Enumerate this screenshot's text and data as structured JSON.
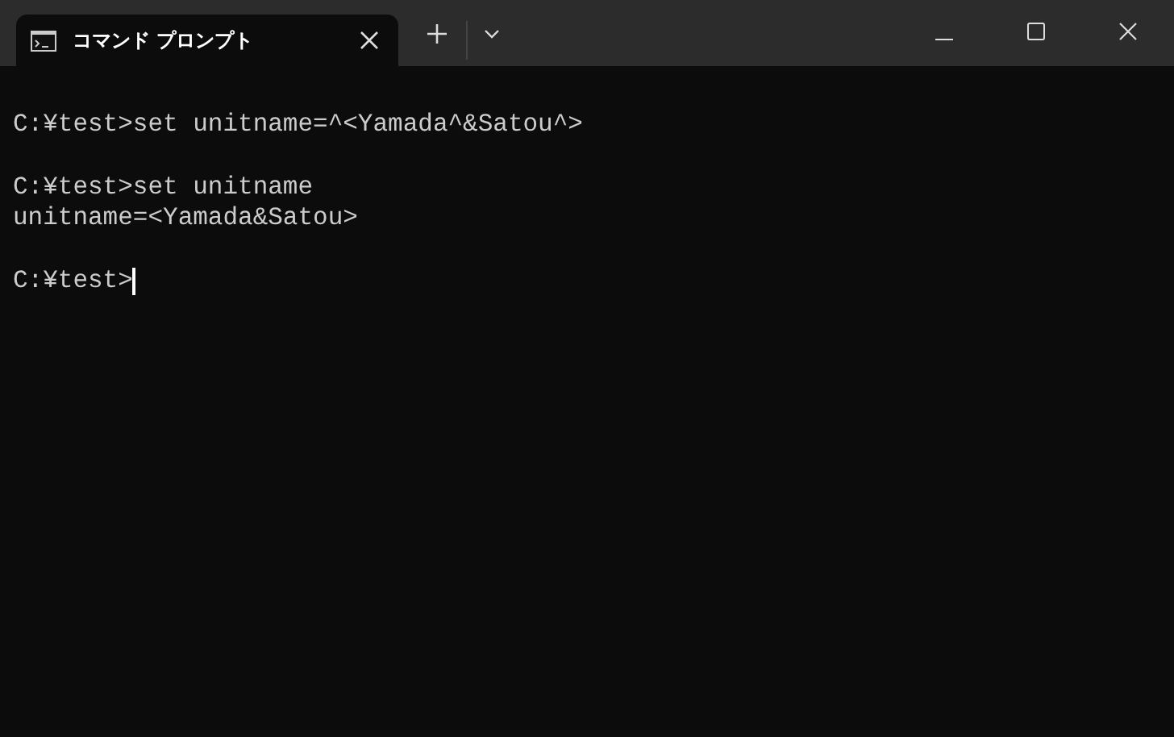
{
  "tab": {
    "title": "コマンド プロンプト",
    "selected": true
  },
  "blocks": [
    {
      "lines": [
        "C:¥test>set unitname=^<Yamada^&Satou^>"
      ]
    },
    {
      "lines": [
        "C:¥test>set unitname",
        "unitname=<Yamada&Satou>"
      ]
    },
    {
      "lines": [
        "C:¥test>"
      ]
    }
  ],
  "cursor": true
}
